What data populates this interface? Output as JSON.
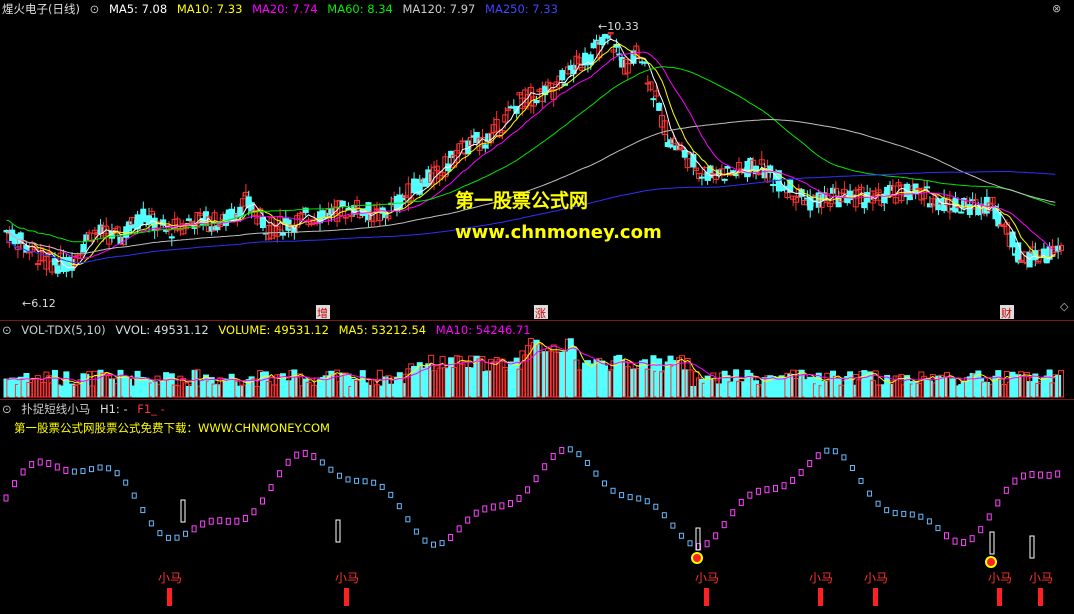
{
  "main_legend": {
    "title": "煋火电子(日线)",
    "ma5": "MA5: 7.08",
    "ma10": "MA10: 7.33",
    "ma20": "MA20: 7.74",
    "ma60": "MA60: 8.34",
    "ma120": "MA120: 7.97",
    "ma250": "MA250: 7.33"
  },
  "vol_legend": {
    "name": "VOL-TDX(5,10)",
    "vvol": "VVOL: 49531.12",
    "volume": "VOLUME: 49531.12",
    "ma5": "MA5: 53212.54",
    "ma10": "MA10: 54246.71"
  },
  "ind_legend": {
    "name": "扑捉短线小马",
    "h1": "H1: -",
    "f1": "F1_ -"
  },
  "promo_text": "第一股票公式网股票公式免费下载：WWW.CHNMONEY.COM",
  "watermark": {
    "line1": "第一股票公式网",
    "line2": "www.chnmoney.com"
  },
  "colors": {
    "up": "#ff3232",
    "down": "#54ffff",
    "ma5": "#ffffff",
    "ma10": "#ffff00",
    "ma20": "#ff00ff",
    "ma60": "#00e600",
    "ma120": "#c0c0c0",
    "ma250": "#3030ff",
    "signal_label": "#ff3030",
    "watermark": "#ffff00"
  },
  "chart_data": {
    "type": "candlestick",
    "price_range": [
      5.8,
      10.6
    ],
    "high_label": "10.33",
    "low_label": "6.12",
    "event_markers": [
      "增",
      "涨",
      "财"
    ],
    "signal_label": "小马",
    "signal_count": 8
  }
}
